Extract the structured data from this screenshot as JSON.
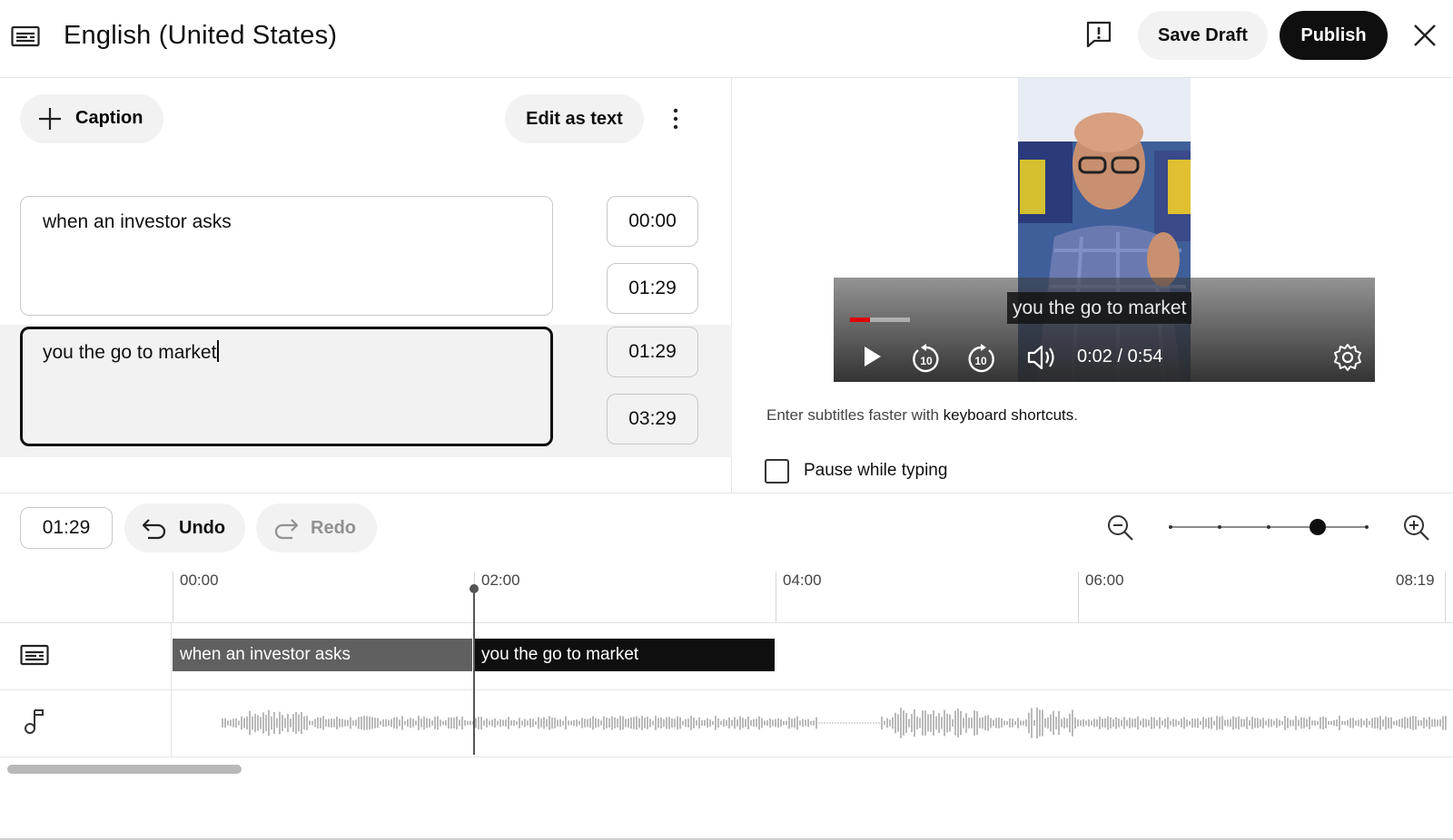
{
  "header": {
    "title": "English (United States)",
    "save_draft_label": "Save Draft",
    "publish_label": "Publish"
  },
  "toolbar": {
    "add_caption_label": "Caption",
    "edit_as_text_label": "Edit as text"
  },
  "captions": [
    {
      "text": "when an investor asks",
      "start": "00:00",
      "end": "01:29",
      "active": false
    },
    {
      "text": "you the go to market",
      "start": "01:29",
      "end": "03:29",
      "active": true
    }
  ],
  "player": {
    "subtitle": "you the go to market",
    "time": "0:02 / 0:54",
    "progress": 0.33
  },
  "hint": {
    "prefix": "Enter subtitles faster with ",
    "link": "keyboard shortcuts",
    "suffix": "."
  },
  "pause_while_typing": {
    "label": "Pause while typing",
    "checked": false
  },
  "timeline_controls": {
    "current_time": "01:29",
    "undo_label": "Undo",
    "redo_label": "Redo",
    "zoom_level": 0.75
  },
  "timeline": {
    "ticks": [
      "00:00",
      "02:00",
      "04:00",
      "06:00",
      "08:19"
    ],
    "segments": [
      {
        "text": "when an investor asks"
      },
      {
        "text": "you the go to market"
      }
    ]
  },
  "colors": {
    "primary": "#0f0f0f",
    "button_bg": "#f2f2f2",
    "progress_red": "#e00000"
  },
  "icons": {
    "header": "subtitles-icon",
    "feedback": "feedback-icon",
    "close": "close-icon",
    "add": "plus-icon",
    "more": "more-vert-icon",
    "undo": "undo-icon",
    "redo": "redo-icon",
    "zoom_out": "zoom-out-icon",
    "zoom_in": "zoom-in-icon",
    "audio": "music-note-icon"
  }
}
